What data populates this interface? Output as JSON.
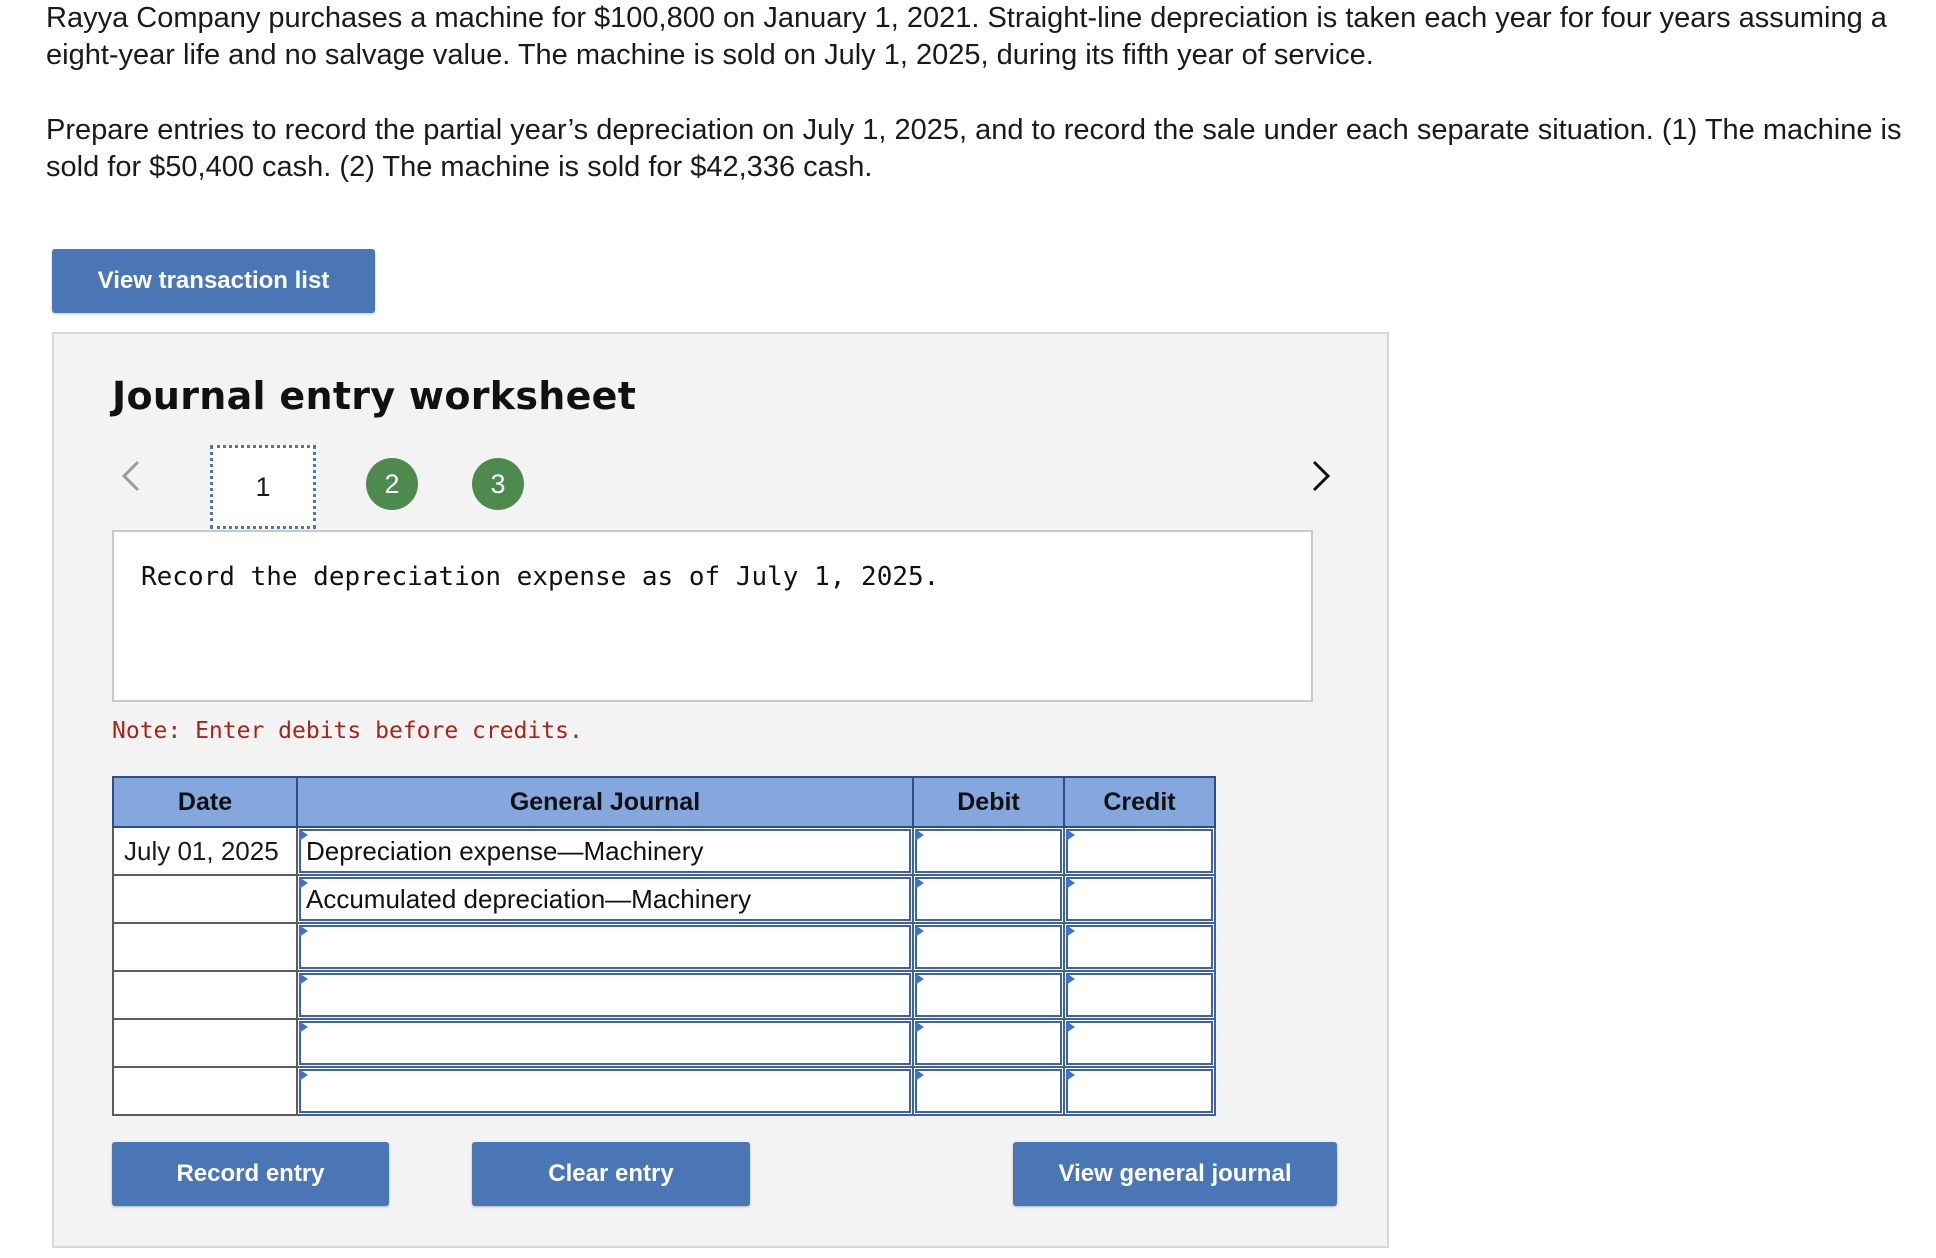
{
  "problem": {
    "paragraph1": "Rayya Company purchases a machine for $100,800 on January 1, 2021. Straight-line depreciation is taken each year for four years assuming a eight-year life and no salvage value. The machine is sold on July 1, 2025, during its fifth year of service.",
    "paragraph2": "Prepare entries to record the partial year’s depreciation on July 1, 2025, and to record the sale under each separate situation. (1) The machine is sold for $50,400 cash. (2) The machine is sold for $42,336 cash."
  },
  "view_transaction_list_label": "View transaction list",
  "worksheet": {
    "title": "Journal entry worksheet",
    "steps": [
      "1",
      "2",
      "3"
    ],
    "current_step": "1",
    "instruction": "Record the depreciation expense as of July 1, 2025.",
    "note": "Note: Enter debits before credits.",
    "table": {
      "headers": {
        "date": "Date",
        "general_journal": "General Journal",
        "debit": "Debit",
        "credit": "Credit"
      },
      "rows": [
        {
          "date": "July 01, 2025",
          "account": "Depreciation expense—Machinery",
          "debit": "",
          "credit": ""
        },
        {
          "date": "",
          "account": "Accumulated depreciation—Machinery",
          "debit": "",
          "credit": ""
        },
        {
          "date": "",
          "account": "",
          "debit": "",
          "credit": ""
        },
        {
          "date": "",
          "account": "",
          "debit": "",
          "credit": ""
        },
        {
          "date": "",
          "account": "",
          "debit": "",
          "credit": ""
        },
        {
          "date": "",
          "account": "",
          "debit": "",
          "credit": ""
        }
      ]
    },
    "buttons": {
      "record_entry": "Record entry",
      "clear_entry": "Clear entry",
      "view_general_journal": "View general journal"
    }
  },
  "colors": {
    "button_blue": "#4a76b6",
    "header_blue": "#84a7de",
    "step_green": "#4e8a4e",
    "note_red": "#a42619"
  }
}
